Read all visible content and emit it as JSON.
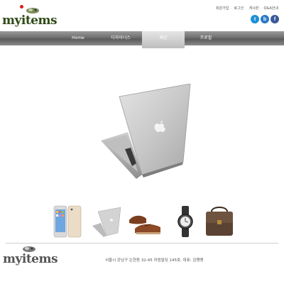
{
  "brand": {
    "logo_text": "myitems"
  },
  "top_links": [
    "회원가입",
    "로그인",
    "게시판",
    "Q&A안내"
  ],
  "social": [
    {
      "name": "twitter-icon",
      "glyph": "t",
      "color": "#1d8fd6"
    },
    {
      "name": "blog-icon",
      "glyph": "b",
      "color": "#2a79c7"
    },
    {
      "name": "facebook-icon",
      "glyph": "f",
      "color": "#3b5998"
    }
  ],
  "nav": {
    "items": [
      {
        "label": "Home"
      },
      {
        "label": "디자이너스"
      },
      {
        "label": "패션"
      },
      {
        "label": "프로필"
      }
    ],
    "active_index": 2
  },
  "hero": {
    "product": "laptop",
    "icon": "apple-logo-icon"
  },
  "thumbnails": [
    {
      "name": "thumb-smartphones"
    },
    {
      "name": "thumb-laptop"
    },
    {
      "name": "thumb-brown-shoes"
    },
    {
      "name": "thumb-wristwatch"
    },
    {
      "name": "thumb-leather-bag"
    }
  ],
  "footer": {
    "logo_text": "myitems",
    "address": "서울시 강남구 논현동 32-45 미림빌딩 145호, 대표: 김땡땡"
  }
}
